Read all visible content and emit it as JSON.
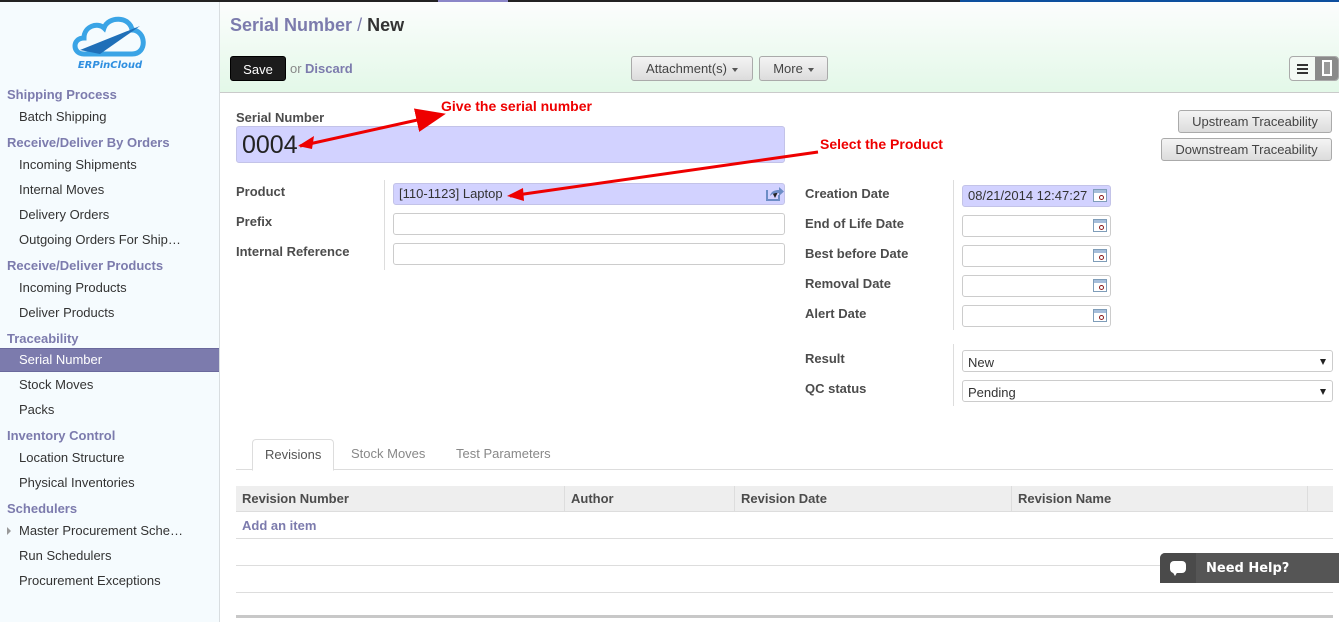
{
  "brand": {
    "logo_text": "ERPinCloud",
    "logo_icon": "cloud-icon"
  },
  "sidebar": {
    "sections": [
      {
        "title": "Shipping Process",
        "items": [
          {
            "label": "Batch Shipping"
          }
        ]
      },
      {
        "title": "Receive/Deliver By Orders",
        "items": [
          {
            "label": "Incoming Shipments"
          },
          {
            "label": "Internal Moves"
          },
          {
            "label": "Delivery Orders"
          },
          {
            "label": "Outgoing Orders For Ship…"
          }
        ]
      },
      {
        "title": "Receive/Deliver Products",
        "items": [
          {
            "label": "Incoming Products"
          },
          {
            "label": "Deliver Products"
          }
        ]
      },
      {
        "title": "Traceability",
        "items": [
          {
            "label": "Serial Number",
            "active": true
          },
          {
            "label": "Stock Moves"
          },
          {
            "label": "Packs"
          }
        ]
      },
      {
        "title": "Inventory Control",
        "items": [
          {
            "label": "Location Structure"
          },
          {
            "label": "Physical Inventories"
          }
        ]
      },
      {
        "title": "Schedulers",
        "items": [
          {
            "label": "Master Procurement Sche…",
            "expandable": true
          },
          {
            "label": "Run Schedulers"
          },
          {
            "label": "Procurement Exceptions"
          }
        ]
      }
    ]
  },
  "header": {
    "breadcrumb": "Serial Number",
    "separator": "/",
    "current": "New",
    "save_label": "Save",
    "or_text": "or",
    "discard_label": "Discard",
    "attachments_label": "Attachment(s)",
    "more_label": "More",
    "view_modes": [
      "list-view-icon",
      "form-view-icon"
    ],
    "active_view": "form"
  },
  "form": {
    "serial_number": {
      "label": "Serial Number",
      "value": "0004"
    },
    "product": {
      "label": "Product",
      "value": "[110-1123] Laptop"
    },
    "prefix": {
      "label": "Prefix",
      "value": ""
    },
    "internal_reference": {
      "label": "Internal Reference",
      "value": ""
    },
    "creation_date": {
      "label": "Creation Date",
      "value": "08/21/2014 12:47:27"
    },
    "end_of_life_date": {
      "label": "End of Life Date",
      "value": ""
    },
    "best_before_date": {
      "label": "Best before Date",
      "value": ""
    },
    "removal_date": {
      "label": "Removal Date",
      "value": ""
    },
    "alert_date": {
      "label": "Alert Date",
      "value": ""
    },
    "result": {
      "label": "Result",
      "value": "New"
    },
    "qc_status": {
      "label": "QC status",
      "value": "Pending"
    },
    "upstream_label": "Upstream Traceability",
    "downstream_label": "Downstream Traceability"
  },
  "annotations": {
    "serial_hint": "Give the serial number",
    "product_hint": "Select the Product",
    "color": "#e00000"
  },
  "tabs": [
    {
      "label": "Revisions",
      "active": true
    },
    {
      "label": "Stock Moves"
    },
    {
      "label": "Test Parameters"
    }
  ],
  "grid": {
    "columns": [
      "Revision Number",
      "Author",
      "Revision Date",
      "Revision Name"
    ],
    "add_item_label": "Add an item",
    "rows": []
  },
  "help": {
    "label": "Need Help?"
  },
  "colors": {
    "accent": "#7c7bad",
    "required_bg": "#d2d2ff",
    "header_gradient_end": "#e3f8e8"
  }
}
